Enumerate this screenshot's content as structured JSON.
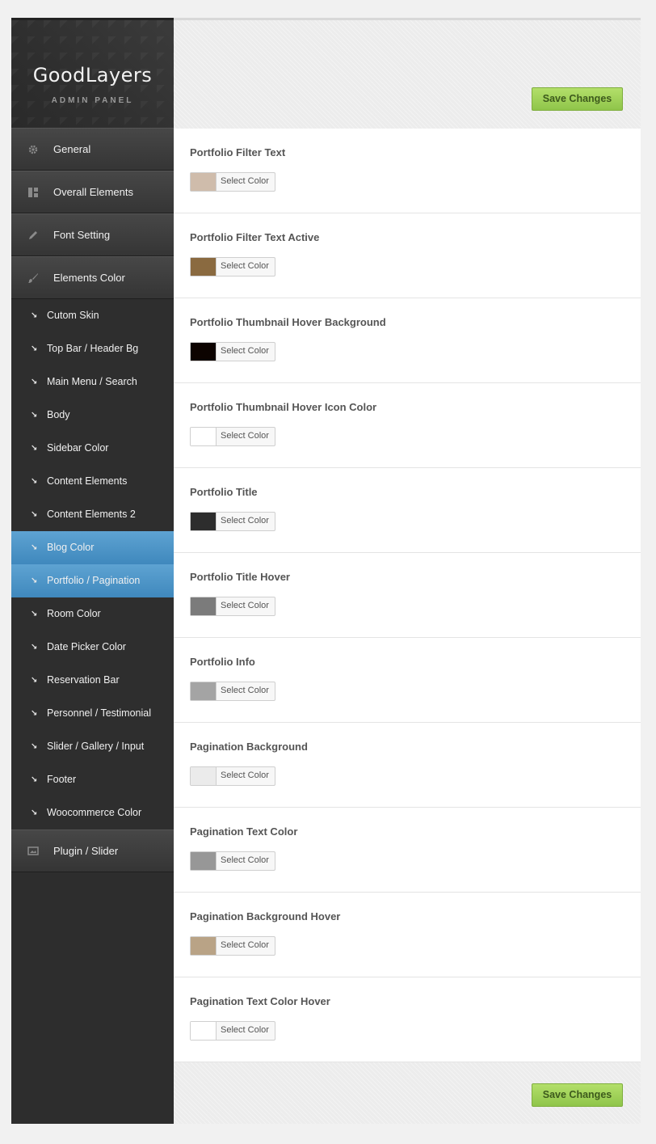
{
  "brand": {
    "title": "GoodLayers",
    "subtitle": "ADMIN PANEL"
  },
  "save_label": "Save Changes",
  "menu": {
    "main_top": [
      {
        "label": "General",
        "icon": "gear-icon"
      },
      {
        "label": "Overall Elements",
        "icon": "layout-icon"
      },
      {
        "label": "Font Setting",
        "icon": "pencil-icon"
      },
      {
        "label": "Elements Color",
        "icon": "brush-icon"
      }
    ],
    "sub": [
      {
        "label": "Cutom Skin",
        "active": false
      },
      {
        "label": "Top Bar / Header Bg",
        "active": false
      },
      {
        "label": "Main Menu / Search",
        "active": false
      },
      {
        "label": "Body",
        "active": false
      },
      {
        "label": "Sidebar Color",
        "active": false
      },
      {
        "label": "Content Elements",
        "active": false
      },
      {
        "label": "Content Elements 2",
        "active": false
      },
      {
        "label": "Blog Color",
        "active": true
      },
      {
        "label": "Portfolio / Pagination",
        "active": true
      },
      {
        "label": "Room Color",
        "active": false
      },
      {
        "label": "Date Picker Color",
        "active": false
      },
      {
        "label": "Reservation Bar",
        "active": false
      },
      {
        "label": "Personnel / Testimonial",
        "active": false
      },
      {
        "label": "Slider / Gallery / Input",
        "active": false
      },
      {
        "label": "Footer",
        "active": false
      },
      {
        "label": "Woocommerce Color",
        "active": false
      }
    ],
    "main_bottom": [
      {
        "label": "Plugin / Slider",
        "icon": "image-icon"
      }
    ]
  },
  "settings": {
    "select_label": "Select Color",
    "rows": [
      {
        "label": "Portfolio Filter Text",
        "color": "#cfbcab"
      },
      {
        "label": "Portfolio Filter Text Active",
        "color": "#8a6a40"
      },
      {
        "label": "Portfolio Thumbnail Hover Background",
        "color": "#0c0300"
      },
      {
        "label": "Portfolio Thumbnail Hover Icon Color",
        "color": "#ffffff"
      },
      {
        "label": "Portfolio Title",
        "color": "#2d2d2d"
      },
      {
        "label": "Portfolio Title Hover",
        "color": "#7b7b7b"
      },
      {
        "label": "Portfolio Info",
        "color": "#a4a4a4"
      },
      {
        "label": "Pagination Background",
        "color": "#ebebeb"
      },
      {
        "label": "Pagination Text Color",
        "color": "#979797"
      },
      {
        "label": "Pagination Background Hover",
        "color": "#b9a386"
      },
      {
        "label": "Pagination Text Color Hover",
        "color": "#ffffff"
      }
    ]
  }
}
